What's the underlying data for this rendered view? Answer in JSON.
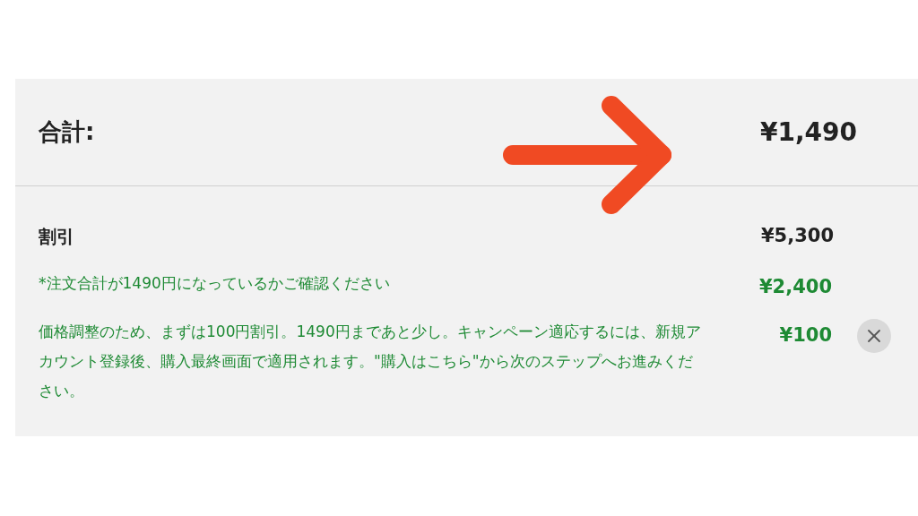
{
  "total": {
    "label": "合計:",
    "amount": "¥1,490"
  },
  "discount": {
    "label": "割引",
    "amount": "¥5,300"
  },
  "discount_lines": [
    {
      "text": "*注文合計が1490円になっているかご確認ください",
      "amount": "¥2,400",
      "removable": false
    },
    {
      "text": "価格調整のため、まずは100円割引。1490円まであと少し。キャンペーン適応するには、新規アカウント登録後、購入最終画面で適用されます。\"購入はこちら\"から次のステップへお進みください。",
      "amount": "¥100",
      "removable": true
    }
  ]
}
